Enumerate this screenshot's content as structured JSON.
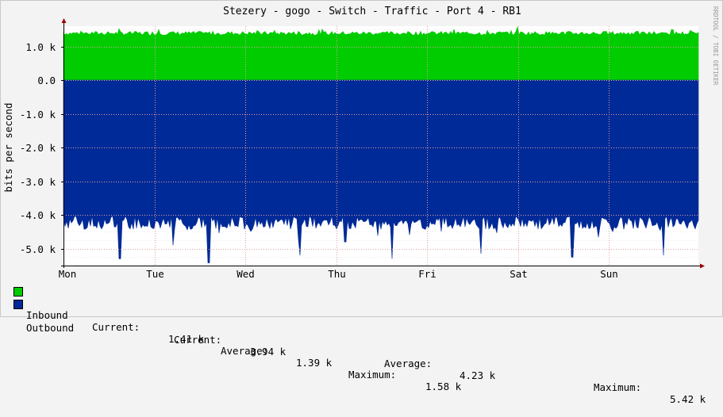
{
  "chart_data": {
    "type": "area",
    "title": "Stezery - gogo - Switch - Traffic - Port  4 - RB1",
    "ylabel": "bits per second",
    "watermark": "RRDTOOL / TOBI OETIKER",
    "x_ticks": [
      "Mon",
      "Tue",
      "Wed",
      "Thu",
      "Fri",
      "Sat",
      "Sun"
    ],
    "y_ticks": [
      {
        "value": 1000,
        "label": "1.0 k"
      },
      {
        "value": 0,
        "label": "0.0"
      },
      {
        "value": -1000,
        "label": "-1.0 k"
      },
      {
        "value": -2000,
        "label": "-2.0 k"
      },
      {
        "value": -3000,
        "label": "-3.0 k"
      },
      {
        "value": -4000,
        "label": "-4.0 k"
      },
      {
        "value": -5000,
        "label": "-5.0 k"
      }
    ],
    "ylim": [
      -5500,
      1600
    ],
    "grid": true,
    "series": [
      {
        "name": "Inbound",
        "color": "#00cc00",
        "sign": 1,
        "base": 1390,
        "noise": 60,
        "spikes": [
          {
            "day": 5.0,
            "value": 1580
          },
          {
            "day": 1.05,
            "value": 1500
          },
          {
            "day": 6.7,
            "value": 1500
          }
        ]
      },
      {
        "name": "Outbound",
        "color": "#002a97",
        "sign": -1,
        "base": 4230,
        "noise": 200,
        "spikes": [
          {
            "day": 0.62,
            "value": 5300
          },
          {
            "day": 1.6,
            "value": 5420
          },
          {
            "day": 2.6,
            "value": 5200
          },
          {
            "day": 3.62,
            "value": 5300
          },
          {
            "day": 4.6,
            "value": 5150
          },
          {
            "day": 5.6,
            "value": 5250
          },
          {
            "day": 6.6,
            "value": 5200
          },
          {
            "day": 1.2,
            "value": 4900
          },
          {
            "day": 3.1,
            "value": 4800
          }
        ]
      }
    ]
  },
  "legend": {
    "inbound": {
      "name": "Inbound",
      "current_label": "Current:",
      "current": "1.41 k",
      "average_label": "Average:",
      "average": "1.39 k",
      "maximum_label": "Maximum:",
      "maximum": "1.58 k"
    },
    "outbound": {
      "name": "Outbound",
      "current_label": "Current:",
      "current": "3.94 k",
      "average_label": "Average:",
      "average": "4.23 k",
      "maximum_label": "Maximum:",
      "maximum": "5.42 k"
    }
  }
}
